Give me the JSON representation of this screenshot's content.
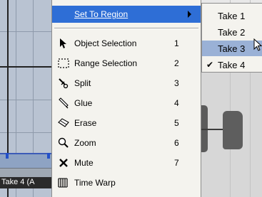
{
  "context_menu": {
    "set_to_region": "Set To Region",
    "items": [
      {
        "id": "object-selection",
        "label": "Object Selection",
        "key": "1"
      },
      {
        "id": "range-selection",
        "label": "Range Selection",
        "key": "2"
      },
      {
        "id": "split",
        "label": "Split",
        "key": "3"
      },
      {
        "id": "glue",
        "label": "Glue",
        "key": "4"
      },
      {
        "id": "erase",
        "label": "Erase",
        "key": "5"
      },
      {
        "id": "zoom",
        "label": "Zoom",
        "key": "6"
      },
      {
        "id": "mute",
        "label": "Mute",
        "key": "7"
      },
      {
        "id": "time-warp",
        "label": "Time Warp",
        "key": ""
      }
    ]
  },
  "submenu": {
    "items": [
      {
        "label": "Take 1",
        "checked": false
      },
      {
        "label": "Take 2",
        "checked": false
      },
      {
        "label": "Take 3",
        "checked": false,
        "hovered": true
      },
      {
        "label": "Take 4",
        "checked": true
      }
    ]
  },
  "event": {
    "label": "Take 4 (A"
  },
  "colors": {
    "highlight": "#2e6ed6",
    "submenu_hover": "#9ab1d6",
    "menu_bg": "#f4f3ee"
  }
}
